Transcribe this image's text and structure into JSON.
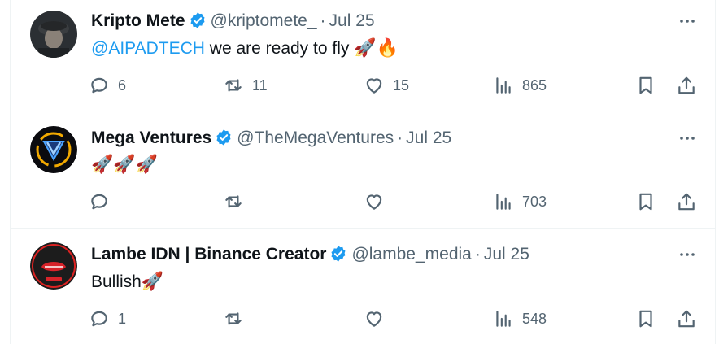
{
  "colors": {
    "link": "#1d9bf0",
    "secondary": "#536471",
    "verified": "#1d9bf0"
  },
  "icons": {
    "reply": "speech-bubble-icon",
    "retweet": "retweet-icon",
    "like": "heart-icon",
    "views": "bar-chart-icon",
    "bookmark": "bookmark-icon",
    "share": "share-icon",
    "more": "ellipsis-icon",
    "verified": "verified-badge-icon"
  },
  "tweets": [
    {
      "name": "Kripto Mete",
      "handle": "@kriptomete_",
      "sep": "·",
      "date": "Jul 25",
      "mention": "@AIPADTECH",
      "text": " we are ready to fly ",
      "emoji": "🚀🔥",
      "replies": "6",
      "retweets": "11",
      "likes": "15",
      "views": "865"
    },
    {
      "name": "Mega Ventures",
      "handle": "@TheMegaVentures",
      "sep": "·",
      "date": "Jul 25",
      "mention": "",
      "text": "",
      "emoji": "🚀🚀🚀",
      "replies": "",
      "retweets": "",
      "likes": "",
      "views": "703"
    },
    {
      "name": "Lambe IDN | Binance Creator",
      "handle": "@lambe_media",
      "sep": "·",
      "date": "Jul 25",
      "mention": "",
      "text": "Bullish",
      "emoji": "🚀",
      "replies": "1",
      "retweets": "",
      "likes": "",
      "views": "548"
    }
  ]
}
